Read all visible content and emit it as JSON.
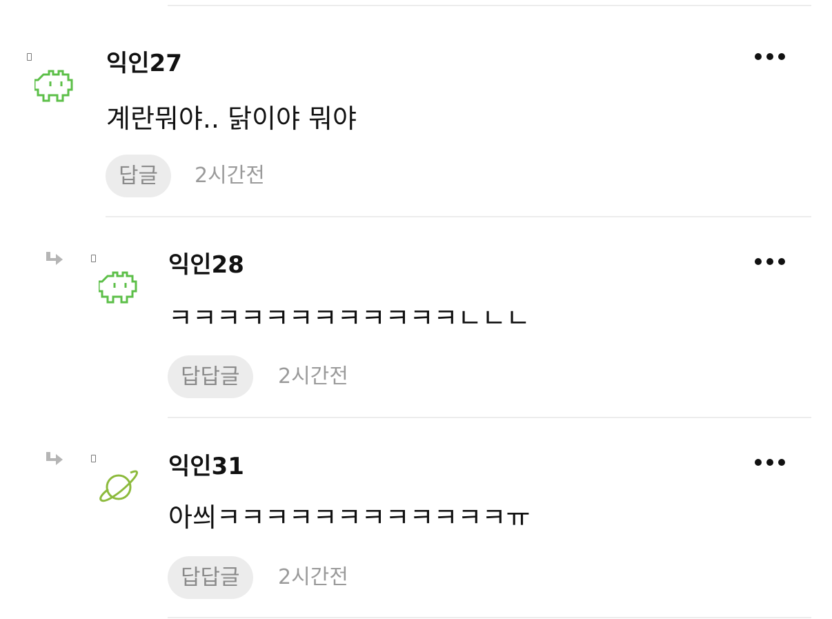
{
  "comments": [
    {
      "username": "익인27",
      "text": "계란뭐야.. 닭이야 뭐야",
      "reply_label": "답글",
      "time": "2시간전",
      "avatar": "space-invader-icon",
      "avatar_color": "#5cbf48",
      "is_reply": false
    },
    {
      "username": "익인28",
      "text": "ㅋㅋㅋㅋㅋㅋㅋㅋㅋㅋㅋㅋㄴㄴㄴ",
      "reply_label": "답답글",
      "time": "2시간전",
      "avatar": "space-invader-icon",
      "avatar_color": "#5cbf48",
      "is_reply": true
    },
    {
      "username": "익인31",
      "text": "아씌ㅋㅋㅋㅋㅋㅋㅋㅋㅋㅋㅋㅋㅠ",
      "reply_label": "답답글",
      "time": "2시간전",
      "avatar": "planet-icon",
      "avatar_color": "#8cba3c",
      "is_reply": true
    }
  ],
  "colors": {
    "divider": "#ececec",
    "pill_bg": "#ececec",
    "muted_text": "#9a9a9a",
    "reply_arrow": "#b5b5b5"
  }
}
